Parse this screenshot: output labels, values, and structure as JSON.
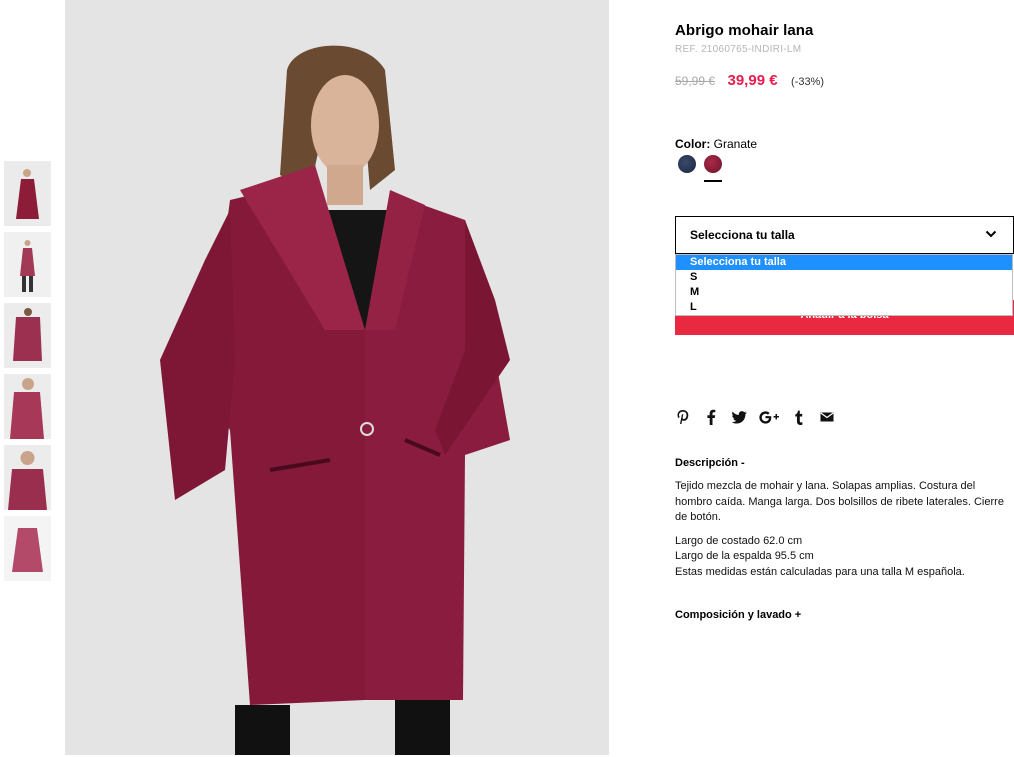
{
  "product": {
    "title": "Abrigo mohair lana",
    "ref": "REF. 21060765-INDIRI-LM",
    "old_price": "59,99 €",
    "new_price": "39,99 €",
    "discount": "(-33%)",
    "color_label": "Color:",
    "color_value": "Granate",
    "colors": [
      "#1f2a45",
      "#8c1c38"
    ]
  },
  "size_select": {
    "label": "Selecciona tu talla",
    "options": [
      "Selecciona tu talla",
      "S",
      "M",
      "L"
    ]
  },
  "add_to_bag_label": "Añadir a la bolsa",
  "share_icons": [
    "pinterest-icon",
    "facebook-icon",
    "twitter-icon",
    "google-plus-icon",
    "tumblr-icon",
    "email-icon"
  ],
  "description": {
    "heading": "Descripción -",
    "text": "Tejido mezcla de mohair y lana. Solapas amplias. Costura del hombro caída. Manga larga. Dos bolsillos de ribete laterales. Cierre de botón.",
    "line1": "Largo de costado 62.0 cm",
    "line2": "Largo de la espalda 95.5 cm",
    "line3": "Estas medidas están calculadas para una talla M española."
  },
  "composition_heading": "Composición y lavado +",
  "colors": {
    "accent_red": "#e8293f",
    "price_red": "#e61e4d",
    "select_blue": "#1e90ff",
    "coat": "#8c1c38"
  }
}
